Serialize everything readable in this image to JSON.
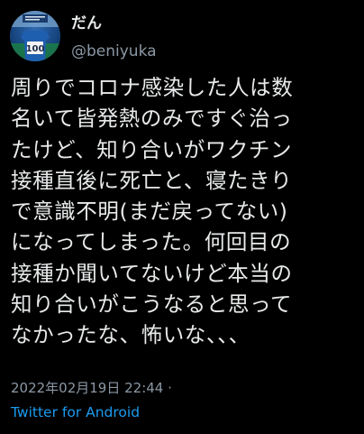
{
  "tweet": {
    "display_name": "だん",
    "handle": "@beniyuka",
    "avatar_icon": "user-avatar-soccer-jersey-icon",
    "avatar_jersey_number": "100",
    "body_lines": [
      "周りでコロナ感染した人は数",
      "名いて皆発熱のみですぐ治っ",
      "たけど、知り合いがワクチン",
      "接種直後に死亡と、寝たきり",
      "で意識不明(まだ戻ってない)",
      "になってしまった。何回目の",
      "接種か聞いてないけど本当の",
      "知り合いがこうなると思って",
      "なかったな、怖いな、、、"
    ],
    "timestamp": "2022年02月19日 22:44 ·",
    "source": "Twitter for Android",
    "colors": {
      "background": "#000000",
      "text": "#e7e9ea",
      "secondary": "#8b98a5",
      "link": "#1d9bf0"
    }
  }
}
